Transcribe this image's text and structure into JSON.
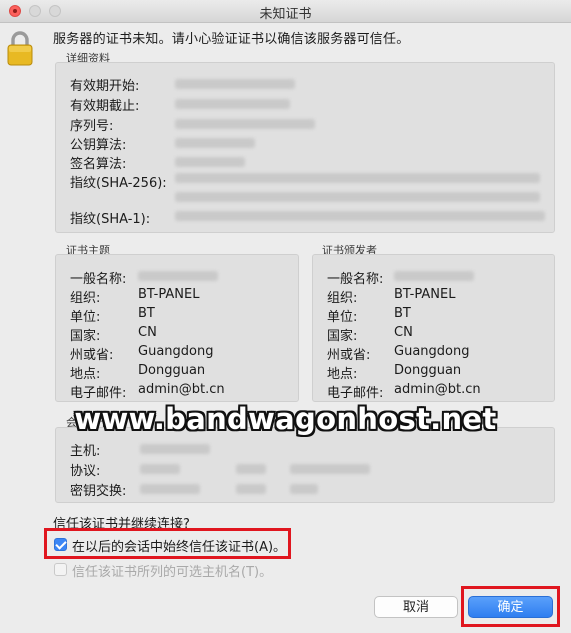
{
  "window": {
    "title": "未知证书"
  },
  "headline": "服务器的证书未知。请小心验证证书以确信该服务器可信任。",
  "details": {
    "label": "详细资料",
    "rows": [
      "有效期开始:",
      "有效期截止:",
      "序列号:",
      "公钥算法:",
      "签名算法:",
      "指纹(SHA-256):",
      "指纹(SHA-1):"
    ]
  },
  "subject": {
    "label": "证书主题",
    "rows": [
      {
        "key": "一般名称:",
        "value": ""
      },
      {
        "key": "组织:",
        "value": "BT-PANEL"
      },
      {
        "key": "单位:",
        "value": "BT"
      },
      {
        "key": "国家:",
        "value": "CN"
      },
      {
        "key": "州或省:",
        "value": "Guangdong"
      },
      {
        "key": "地点:",
        "value": "Dongguan"
      },
      {
        "key": "电子邮件:",
        "value": "admin@bt.cn"
      }
    ]
  },
  "issuer": {
    "label": "证书颁发者",
    "rows": [
      {
        "key": "一般名称:",
        "value": ""
      },
      {
        "key": "组织:",
        "value": "BT-PANEL"
      },
      {
        "key": "单位:",
        "value": "BT"
      },
      {
        "key": "国家:",
        "value": "CN"
      },
      {
        "key": "州或省:",
        "value": "Guangdong"
      },
      {
        "key": "地点:",
        "value": "Dongguan"
      },
      {
        "key": "电子邮件:",
        "value": "admin@bt.cn"
      }
    ]
  },
  "session": {
    "label": "会话细节",
    "rows": [
      "主机:",
      "协议:",
      "密钥交换:"
    ]
  },
  "trust": {
    "question": "信任该证书并继续连接?",
    "always_trust_label": "在以后的会话中始终信任该证书(A)。",
    "always_trust_checked": true,
    "alt_names_label": "信任该证书所列的可选主机名(T)。",
    "alt_names_checked": false
  },
  "buttons": {
    "cancel": "取消",
    "ok": "确定"
  },
  "watermark": "www.bandwagonhost.net",
  "colors": {
    "accent": "#2f7ef0",
    "highlight": "#e0161f"
  }
}
